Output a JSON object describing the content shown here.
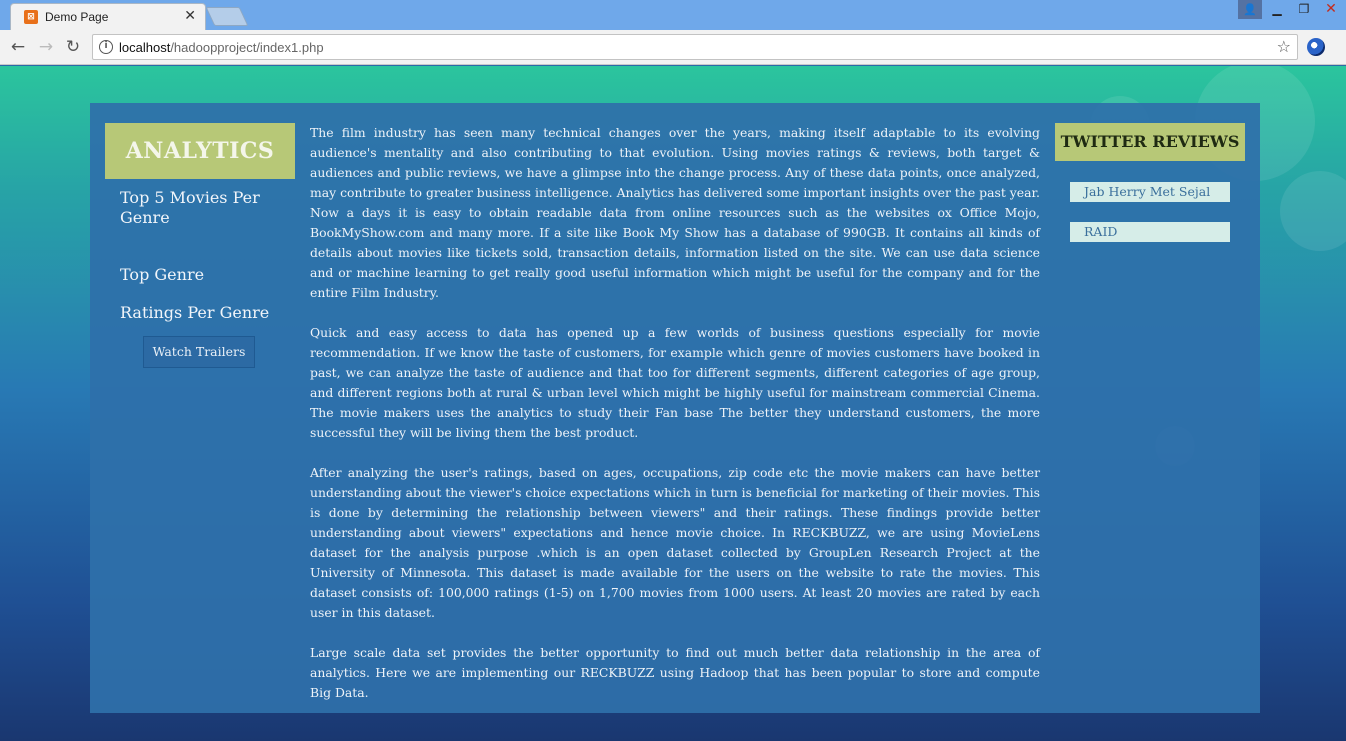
{
  "browser": {
    "tab_title": "Demo Page",
    "tab_close": "✕",
    "url_host": "localhost",
    "url_path": "/hadoopproject/index1.php"
  },
  "sidebar": {
    "header": "ANALYTICS",
    "links": [
      "Top 5 Movies Per Genre",
      "Top Genre",
      "Ratings Per Genre"
    ],
    "watch_button": "Watch Trailers"
  },
  "main": {
    "paragraphs": [
      "The film industry has seen many technical changes over the years, making itself adaptable to its evolving audience's mentality and also contributing to that evolution. Using movies ratings & reviews, both target & audiences and public reviews, we have a glimpse into the change process. Any of these data points, once analyzed, may contribute to greater business intelligence. Analytics has delivered some important insights over the past year. Now a days it is easy to obtain readable data from online resources such as the websites ox Office Mojo, BookMyShow.com and many more. If a site like Book My Show has a database of 990GB. It contains all kinds of details about movies like tickets sold, transaction details, information listed on the site. We can use data science and or machine learning to get really good useful information which might be useful for the company and for the entire Film Industry.",
      "Quick and easy access to data has opened up a few worlds of business questions especially for movie recommendation. If we know the taste of customers, for example which genre of movies customers have booked in past, we can analyze the taste of audience and that too for different segments, different categories of age group, and different regions both at rural & urban level which might be highly useful for mainstream commercial Cinema. The movie makers uses the analytics to study their Fan base The better they understand customers, the more successful they will be living them the best product.",
      "After analyzing the user's ratings, based on ages, occupations, zip code etc the movie makers can have better understanding about the viewer's choice expectations which in turn is beneficial for marketing of their movies. This is done by determining the relationship between viewers\" and their ratings. These findings provide better understanding about viewers\" expectations and hence movie choice. In RECKBUZZ, we are using MovieLens dataset for the analysis purpose .which is an open dataset collected by GroupLen Research Project at the University of Minnesota. This dataset is made available for the users on the website to rate the movies. This dataset consists of: 100,000 ratings (1-5) on 1,700 movies from 1000 users. At least 20 movies are rated by each user in this dataset.",
      "Large scale data set provides the better opportunity to find out much better data relationship in the area of analytics. Here we are implementing our RECKBUZZ using Hadoop that has been popular to store and compute Big Data."
    ]
  },
  "twitter": {
    "header": "TWITTER REVIEWS",
    "items": [
      "Jab Herry Met Sejal",
      "RAID"
    ]
  },
  "colors": {
    "header_accent": "#b7c877",
    "panel": "#2e70aa",
    "review_item_bg": "#d6ede8"
  }
}
